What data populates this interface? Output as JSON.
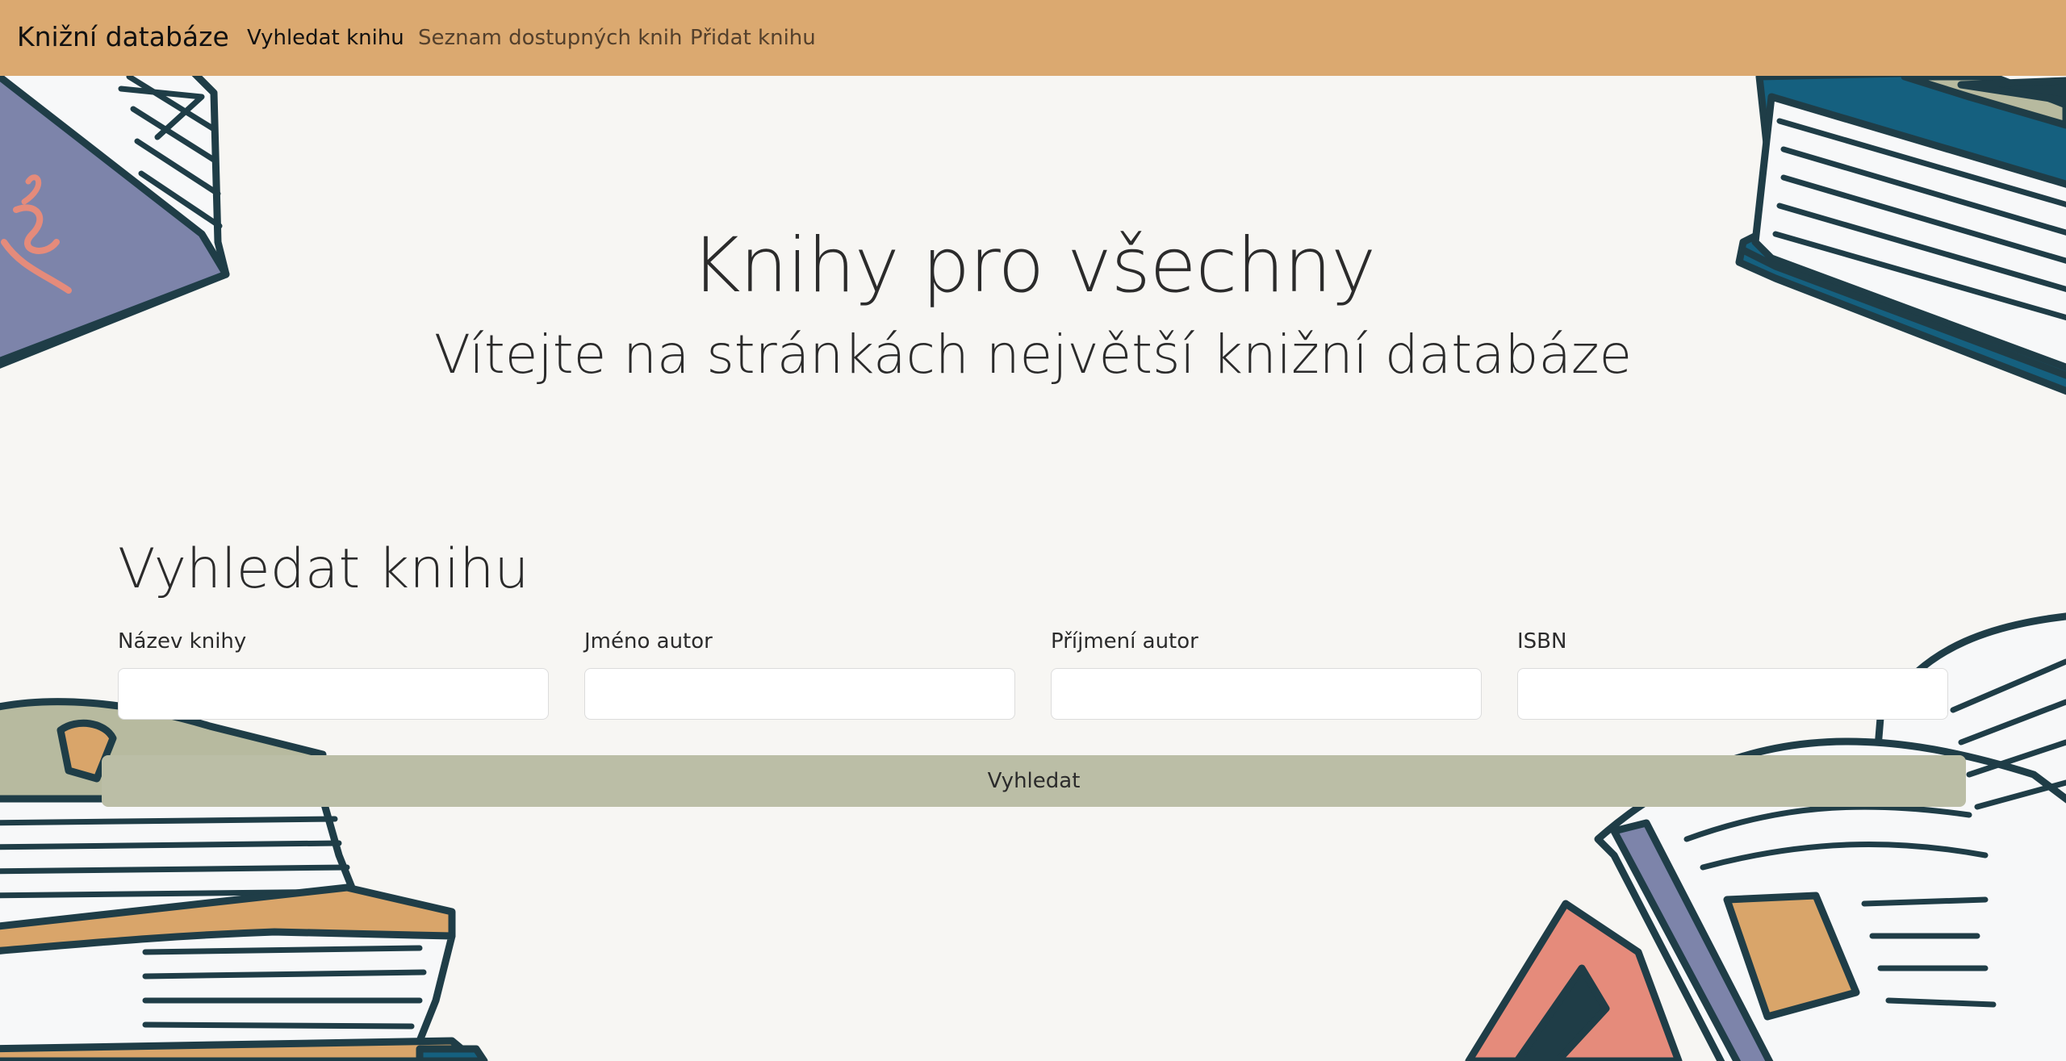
{
  "navbar": {
    "brand": "Knižní databáze",
    "links": [
      {
        "label": "Vyhledat knihu",
        "active": true
      },
      {
        "label": "Seznam dostupných knih",
        "active": false
      },
      {
        "label": "Přidat knihu",
        "active": false
      }
    ]
  },
  "hero": {
    "title": "Knihy pro všechny",
    "subtitle": "Vítejte na stránkách největší knižní databáze"
  },
  "search": {
    "heading": "Vyhledat knihu",
    "fields": [
      {
        "label": "Název knihy",
        "value": "",
        "placeholder": ""
      },
      {
        "label": "Jméno autor",
        "value": "",
        "placeholder": ""
      },
      {
        "label": "Příjmení autor",
        "value": "",
        "placeholder": ""
      },
      {
        "label": "ISBN",
        "value": "",
        "placeholder": ""
      }
    ],
    "button_label": "Vyhledat"
  },
  "colors": {
    "navbar_bg": "#dba970",
    "page_bg": "#f7f6f3",
    "button_bg": "#bbbea6",
    "outline": "#1f3d47",
    "book_blue": "#15607f",
    "book_purple": "#7d84aa",
    "book_tan": "#d9a56a",
    "book_olive": "#b7ba9f",
    "book_salmon": "#e58b7b"
  },
  "background_art": "book-illustrations"
}
